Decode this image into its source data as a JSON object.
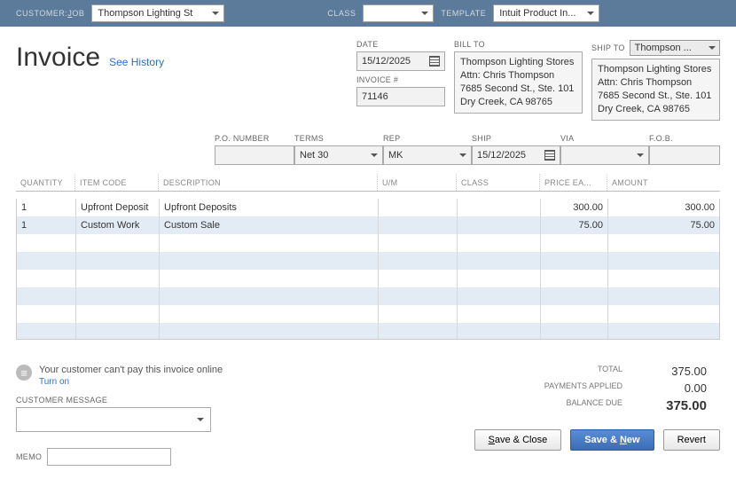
{
  "topbar": {
    "customer_job_label": "CUSTOMER:",
    "customer_job_label2": "OB",
    "customer_job_value": "Thompson Lighting St",
    "class_label": "CLASS",
    "class_value": "",
    "template_label": "TEMPLATE",
    "template_value": "Intuit Product In..."
  },
  "header": {
    "title": "Invoice",
    "see_history": "See History",
    "date_label": "DATE",
    "date_value": "15/12/2025",
    "invoice_no_label": "INVOICE #",
    "invoice_no_value": "71146",
    "bill_to_label": "BILL TO",
    "ship_to_label": "SHIP TO",
    "ship_to_select": "Thompson ...",
    "bill_address": "Thompson Lighting Stores\nAttn: Chris Thompson\n7685 Second St., Ste. 101\nDry Creek, CA 98765",
    "ship_address": "Thompson Lighting Stores\nAttn: Chris Thompson\n7685 Second St., Ste. 101\nDry Creek, CA 98765"
  },
  "fields": {
    "po_label": "P.O. NUMBER",
    "po_value": "",
    "terms_label": "TERMS",
    "terms_value": "Net 30",
    "rep_label": "REP",
    "rep_value": "MK",
    "ship_label": "SHIP",
    "ship_value": "15/12/2025",
    "via_label": "VIA",
    "via_value": "",
    "fob_label": "F.O.B.",
    "fob_value": ""
  },
  "columns": {
    "qty": "QUANTITY",
    "item": "ITEM CODE",
    "desc": "DESCRIPTION",
    "um": "U/M",
    "class": "CLASS",
    "price": "PRICE EA...",
    "amount": "AMOUNT"
  },
  "rows": [
    {
      "qty": "1",
      "item": "Upfront Deposit",
      "desc": "Upfront Deposits",
      "um": "",
      "class": "",
      "price": "300.00",
      "amount": "300.00"
    },
    {
      "qty": "1",
      "item": "Custom Work",
      "desc": "Custom Sale",
      "um": "",
      "class": "",
      "price": "75.00",
      "amount": "75.00"
    }
  ],
  "footer": {
    "online_msg": "Your customer can't pay this invoice online",
    "turn_on": "Turn on",
    "cust_msg_label": "CUSTOMER MESSAGE",
    "memo_label": "MEMO",
    "total_label": "TOTAL",
    "total_value": "375.00",
    "payments_label": "PAYMENTS APPLIED",
    "payments_value": "0.00",
    "balance_label": "BALANCE DUE",
    "balance_value": "375.00"
  },
  "buttons": {
    "save_close": "ave & Close",
    "save_close_u": "S",
    "save_new": "Save & ",
    "save_new_u": "N",
    "save_new_after": "ew",
    "revert": "Revert"
  }
}
